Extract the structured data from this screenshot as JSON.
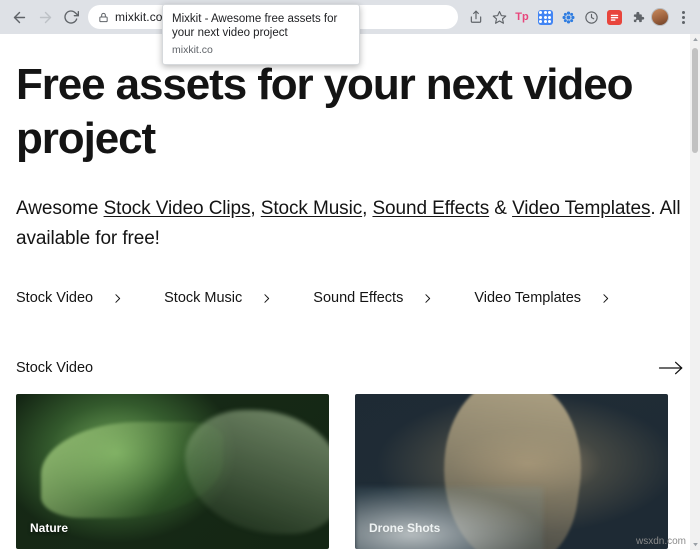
{
  "browser": {
    "nav": {
      "back_label": "Back",
      "forward_label": "Forward",
      "reload_label": "Reload"
    },
    "omnibox": {
      "url": "mixkit.co",
      "lock_icon": "lock-icon"
    },
    "toolbar_icons": [
      {
        "name": "share-icon",
        "label": ""
      },
      {
        "name": "bookmark-star-icon",
        "label": ""
      },
      {
        "name": "extension-tp-icon",
        "label": "Tp"
      },
      {
        "name": "extension-apps-icon",
        "label": ""
      },
      {
        "name": "extension-flower-icon",
        "label": ""
      },
      {
        "name": "extension-clock-icon",
        "label": ""
      },
      {
        "name": "extension-red-icon",
        "label": ""
      },
      {
        "name": "extensions-puzzle-icon",
        "label": ""
      },
      {
        "name": "profile-avatar",
        "label": ""
      },
      {
        "name": "chrome-menu-icon",
        "label": ""
      }
    ]
  },
  "tooltip": {
    "title": "Mixkit - Awesome free assets for your next video project",
    "url": "mixkit.co"
  },
  "page": {
    "hero_title": "Free assets for your next video project",
    "subtitle": {
      "lead": "Awesome ",
      "link1": "Stock Video Clips",
      "sep1": ", ",
      "link2": "Stock Music",
      "sep2": ", ",
      "link3": "Sound Effects",
      "sep3": " & ",
      "link4": "Video Templates",
      "tail": ". All available for free!"
    },
    "nav_items": [
      {
        "label": "Stock Video",
        "arrow": "chevron-right-icon"
      },
      {
        "label": "Stock Music",
        "arrow": "chevron-right-icon"
      },
      {
        "label": "Sound Effects",
        "arrow": "chevron-right-icon"
      },
      {
        "label": "Video Templates",
        "arrow": "chevron-right-icon"
      }
    ],
    "section": {
      "title": "Stock Video",
      "more_arrow": "arrow-right-icon"
    },
    "cards": [
      {
        "label": "Nature"
      },
      {
        "label": "Drone Shots"
      }
    ]
  },
  "watermark": "wsxdn.com",
  "colors": {
    "chrome_bg": "#dee1e6",
    "omnibox_bg": "#ffffff",
    "text": "#141414",
    "muted": "#5f6368",
    "scrollbar_thumb": "#c1c1c1"
  }
}
